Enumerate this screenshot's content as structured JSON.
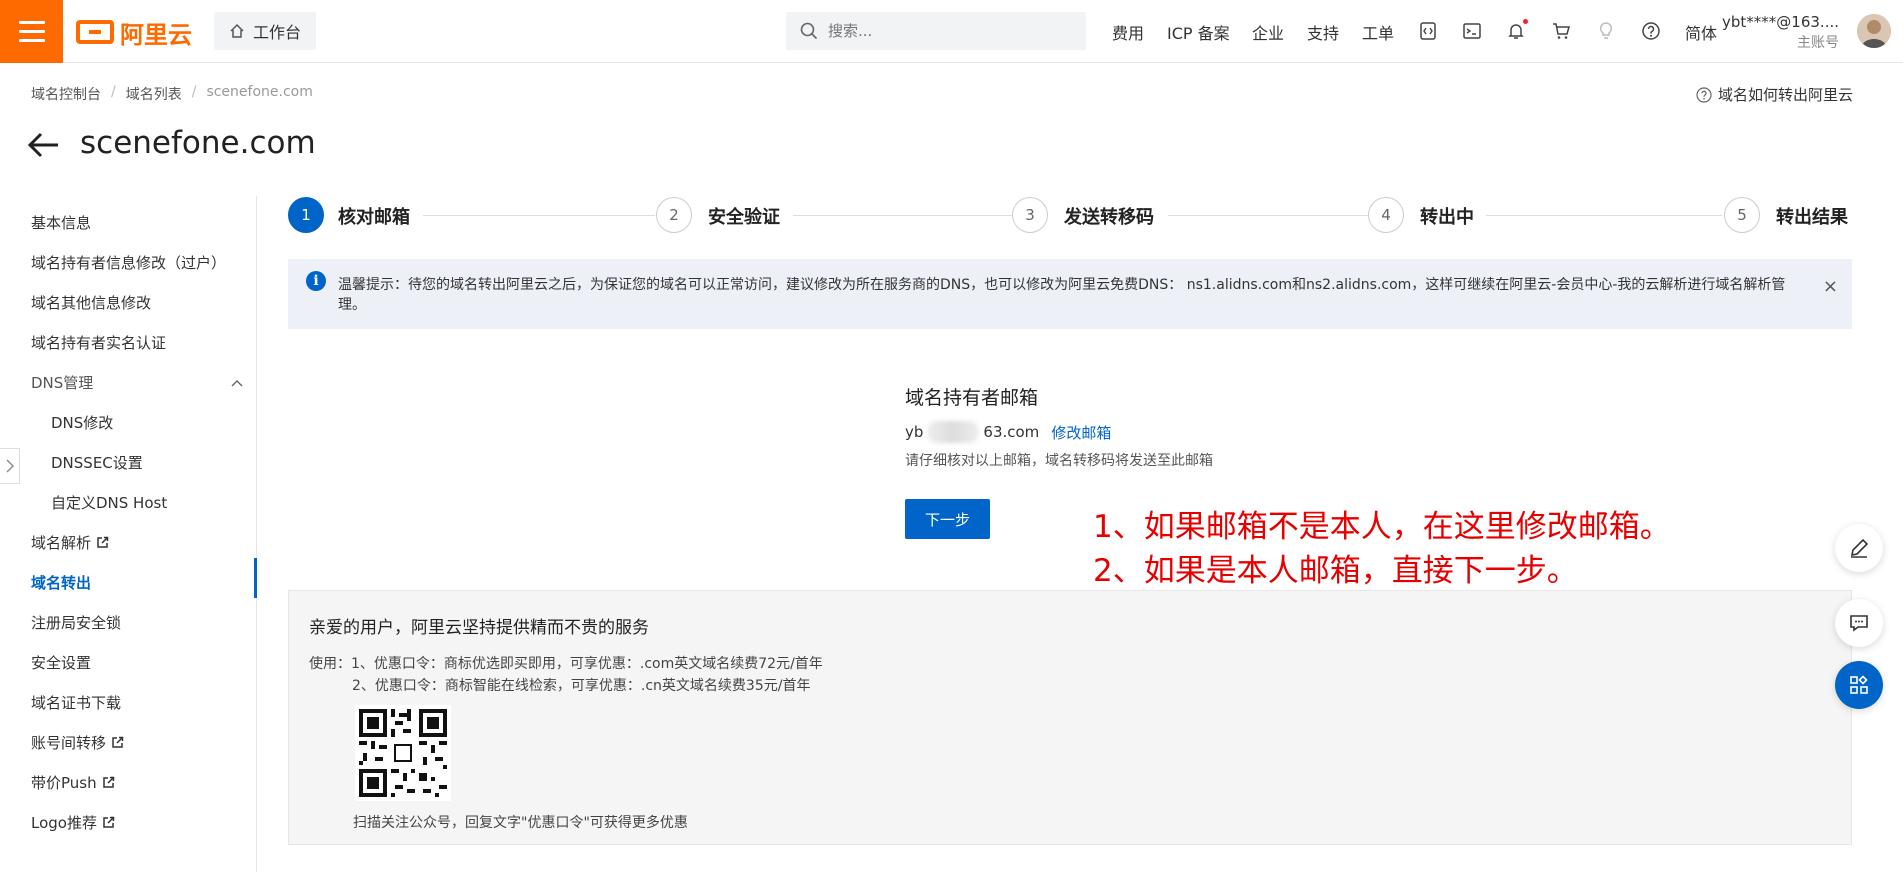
{
  "topbar": {
    "brand": "阿里云",
    "workbench": "工作台",
    "search_placeholder": "搜索...",
    "nav": [
      "费用",
      "ICP 备案",
      "企业",
      "支持",
      "工单"
    ],
    "lang": "简体",
    "account_name": "ybt****@163....",
    "account_type": "主账号"
  },
  "breadcrumb": [
    "域名控制台",
    "域名列表",
    "scenefone.com"
  ],
  "help_link": "域名如何转出阿里云",
  "page_title": "scenefone.com",
  "sidebar": {
    "items": [
      {
        "label": "基本信息"
      },
      {
        "label": "域名持有者信息修改（过户）"
      },
      {
        "label": "域名其他信息修改"
      },
      {
        "label": "域名持有者实名认证"
      },
      {
        "label": "DNS管理"
      },
      {
        "label": "DNS修改"
      },
      {
        "label": "DNSSEC设置"
      },
      {
        "label": "自定义DNS Host"
      },
      {
        "label": "域名解析"
      },
      {
        "label": "域名转出"
      },
      {
        "label": "注册局安全锁"
      },
      {
        "label": "安全设置"
      },
      {
        "label": "域名证书下载"
      },
      {
        "label": "账号间转移"
      },
      {
        "label": "带价Push"
      },
      {
        "label": "Logo推荐"
      }
    ]
  },
  "steps": [
    {
      "num": "1",
      "label": "核对邮箱"
    },
    {
      "num": "2",
      "label": "安全验证"
    },
    {
      "num": "3",
      "label": "发送转移码"
    },
    {
      "num": "4",
      "label": "转出中"
    },
    {
      "num": "5",
      "label": "转出结果"
    }
  ],
  "notice": {
    "text": "温馨提示：待您的域名转出阿里云之后，为保证您的域名可以正常访问，建议修改为所在服务商的DNS，也可以修改为阿里云免费DNS： ns1.alidns.com和ns2.alidns.com，这样可继续在阿里云-会员中心-我的云解析进行域名解析管理。"
  },
  "email": {
    "title": "域名持有者邮箱",
    "prefix": "yb",
    "suffix": "63.com",
    "edit_label": "修改邮箱",
    "hint": "请仔细核对以上邮箱，域名转移码将发送至此邮箱",
    "next_label": "下一步"
  },
  "annotation": {
    "line1": "1、如果邮箱不是本人，在这里修改邮箱。",
    "line2": "2、如果是本人邮箱，直接下一步。"
  },
  "promo": {
    "title": "亲爱的用户，阿里云坚持提供精而不贵的服务",
    "line1": "使用：1、优惠口令：商标优选即买即用，可享优惠：.com英文域名续费72元/首年",
    "line2": "2、优惠口令：商标智能在线检索，可享优惠：.cn英文域名续费35元/首年",
    "qr_caption": "扫描关注公众号，回复文字\"优惠口令\"可获得更多优惠"
  },
  "colors": {
    "brand_orange": "#ff6a00",
    "primary_blue": "#0064c8",
    "annotation_red": "#e60000"
  }
}
